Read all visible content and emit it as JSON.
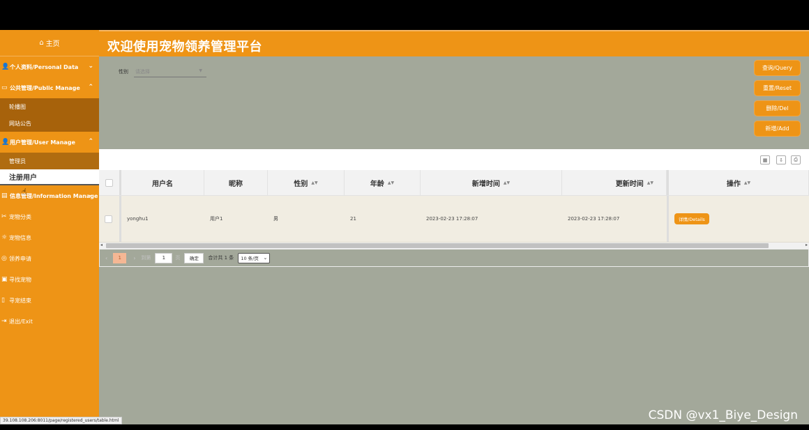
{
  "sidebar": {
    "home_label": "主页",
    "menus": [
      {
        "label": "个人资料/Personal Data",
        "chevron": "⌄",
        "icon": "user-icon"
      },
      {
        "label": "公共管理/Public Manage",
        "chevron": "⌃",
        "icon": "screen-icon"
      }
    ],
    "public_sub": [
      "轮播图",
      "网站公告"
    ],
    "user_menu": {
      "label": "用户管理/User Manage",
      "chevron": "⌃"
    },
    "user_sub": [
      "管理员",
      "注册用户"
    ],
    "info_menu": {
      "label": "信息管理/Information Manage",
      "chevron": "⌄"
    },
    "items": [
      "宠物分类",
      "宠物信息",
      "领养申请",
      "寻找宠物",
      "寻宠结束",
      "退出/Exit"
    ]
  },
  "header": {
    "title": "欢迎使用宠物领养管理平台"
  },
  "filter": {
    "label": "性别",
    "placeholder": "请选择"
  },
  "actions": {
    "query": "查询/Query",
    "reset": "重置/Reset",
    "delete": "删除/Del",
    "add": "新增/Add"
  },
  "table": {
    "headers": [
      "用户名",
      "昵称",
      "性别",
      "年龄",
      "新增时间",
      "更新时间",
      "操作"
    ],
    "rows": [
      {
        "username": "yonghu1",
        "nickname": "用户1",
        "gender": "男",
        "age": "21",
        "created": "2023-02-23 17:28:07",
        "updated": "2023-02-23 17:28:07",
        "action": "详情/Details"
      }
    ]
  },
  "pager": {
    "page": "1",
    "to_label": "到第",
    "input_value": "1",
    "page_suffix": "页",
    "go": "确定",
    "total": "合计共 1 条",
    "page_size": "10 条/页"
  },
  "status_url": "39.108.108.206:8011/page/registered_users/table.html",
  "watermark": "CSDN @vx1_Biye_Design"
}
